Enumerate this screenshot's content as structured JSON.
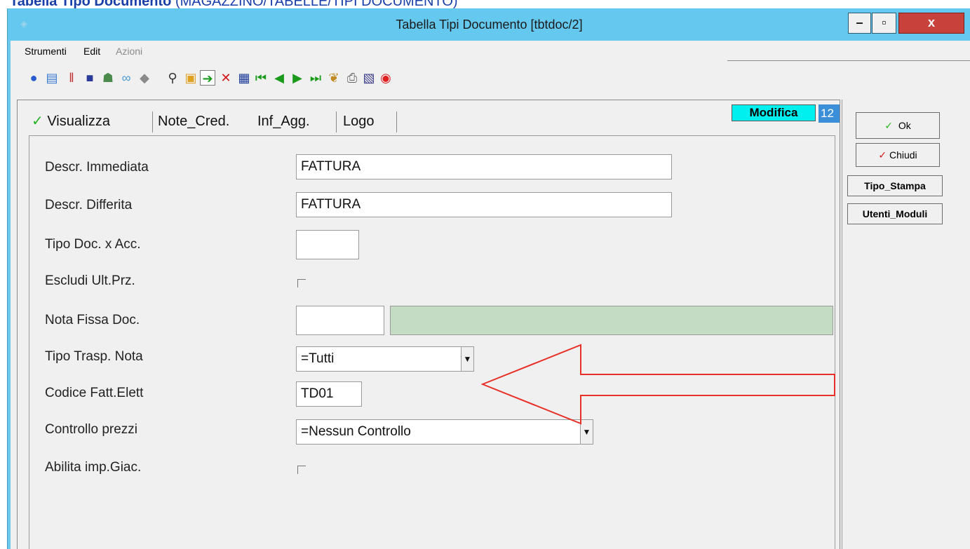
{
  "page_caption": {
    "bold": "Tabella Tipo Documento",
    "rest": " (MAGAZZINO/TABELLE/TIPI DOCUMENTO)"
  },
  "window": {
    "title": "Tabella Tipi Documento [tbtdoc/2]",
    "controls": {
      "minimize": "–",
      "maximize": "▫",
      "close": "x"
    }
  },
  "menu": [
    "Strumenti",
    "Edit",
    "Azioni"
  ],
  "toolbar_icons": [
    "help-icon",
    "note-icon",
    "separator-icon",
    "monitor-icon",
    "users-icon",
    "link-icon",
    "diamond-icon",
    "search-icon",
    "folder-icon",
    "enter-icon",
    "delete-icon",
    "grid-icon",
    "first-icon",
    "prev-icon",
    "next-icon",
    "last-icon",
    "book-icon",
    "print-icon",
    "document-icon",
    "stop-icon"
  ],
  "tabs": [
    {
      "label": "Visualizza",
      "checked": true
    },
    {
      "label": "Note_Cred."
    },
    {
      "label": "Inf_Agg."
    },
    {
      "label": "Logo"
    }
  ],
  "status": {
    "mode": "Modifica",
    "badge": "12"
  },
  "form": {
    "descr_immediata": {
      "label": "Descr. Immediata",
      "value": "FATTURA"
    },
    "descr_differita": {
      "label": "Descr. Differita",
      "value": "FATTURA"
    },
    "tipo_doc_acc": {
      "label": "Tipo Doc. x Acc.",
      "value": ""
    },
    "escludi_ult_prz": {
      "label": "Escludi Ult.Prz.",
      "checked": false
    },
    "nota_fissa_doc": {
      "label": "Nota Fissa Doc.",
      "value": "",
      "desc": ""
    },
    "tipo_trasp_nota": {
      "label": "Tipo Trasp. Nota",
      "value": "=Tutti"
    },
    "codice_fatt_elett": {
      "label": "Codice Fatt.Elett",
      "value": "TD01"
    },
    "controllo_prezzi": {
      "label": "Controllo prezzi",
      "value": "=Nessun Controllo"
    },
    "abilita_imp_giac": {
      "label": "Abilita imp.Giac.",
      "checked": false
    }
  },
  "side_buttons": {
    "ok": "Ok",
    "chiudi": "Chiudi",
    "tipo_stampa": "Tipo_Stampa",
    "utenti_moduli": "Utenti_Moduli"
  },
  "colors": {
    "titlebar": "#64c8ef",
    "modifica_bg": "#00f0f0",
    "green_field": "#c4dcc4",
    "annotation_arrow": "#e8302a"
  }
}
